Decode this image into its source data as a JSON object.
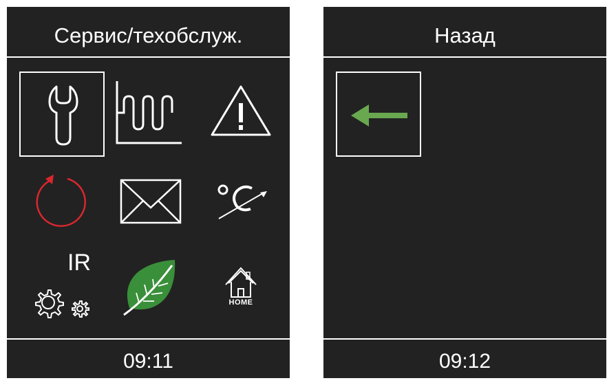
{
  "screens": [
    {
      "title": "Сервис/техобслуж.",
      "time": "09:11",
      "tiles": [
        {
          "icon": "wrench-icon",
          "selected": true
        },
        {
          "icon": "heating-coil-icon"
        },
        {
          "icon": "warning-icon"
        },
        {
          "icon": "reset-arrow-icon"
        },
        {
          "icon": "envelope-icon"
        },
        {
          "icon": "temperature-calibration-icon"
        },
        {
          "icon": "ir-gears-icon",
          "label": "IR"
        },
        {
          "icon": "eco-leaf-icon"
        },
        {
          "icon": "home-icon",
          "label": "HOME"
        }
      ]
    },
    {
      "title": "Назад",
      "time": "09:12",
      "tiles": [
        {
          "icon": "back-arrow-icon",
          "selected": true
        }
      ]
    }
  ],
  "colors": {
    "screen_bg": "#222222",
    "foreground": "#ffffff",
    "reset_arrow": "#d9272e",
    "leaf": "#3a8f3a",
    "back_arrow": "#6aa84f"
  }
}
